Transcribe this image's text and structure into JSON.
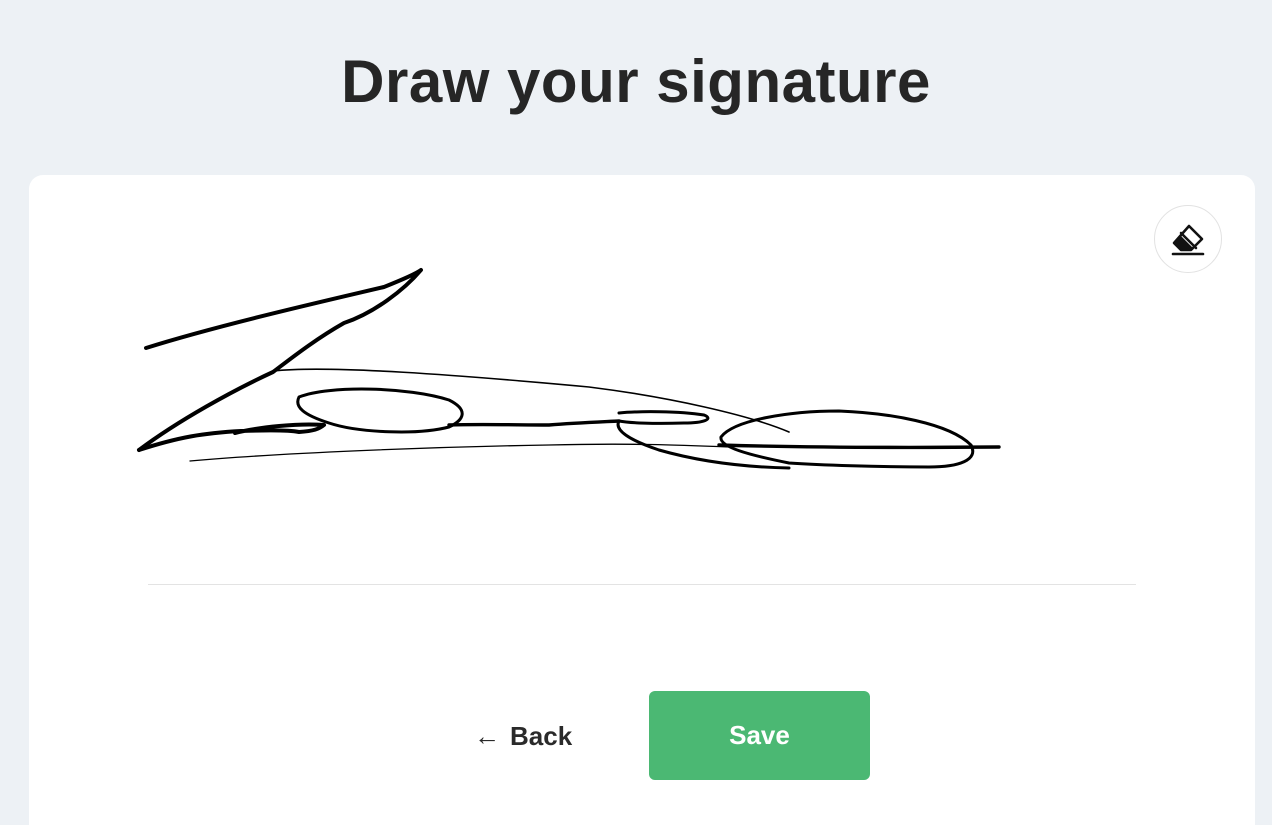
{
  "header": {
    "title": "Draw your signature"
  },
  "pad": {
    "clear_icon": "eraser-icon",
    "stroke_color": "#000000"
  },
  "actions": {
    "back_label": "Back",
    "back_icon": "arrow-left-icon",
    "save_label": "Save"
  },
  "colors": {
    "background": "#edf1f5",
    "card": "#ffffff",
    "save_button": "#4bb873",
    "text": "#262626"
  }
}
